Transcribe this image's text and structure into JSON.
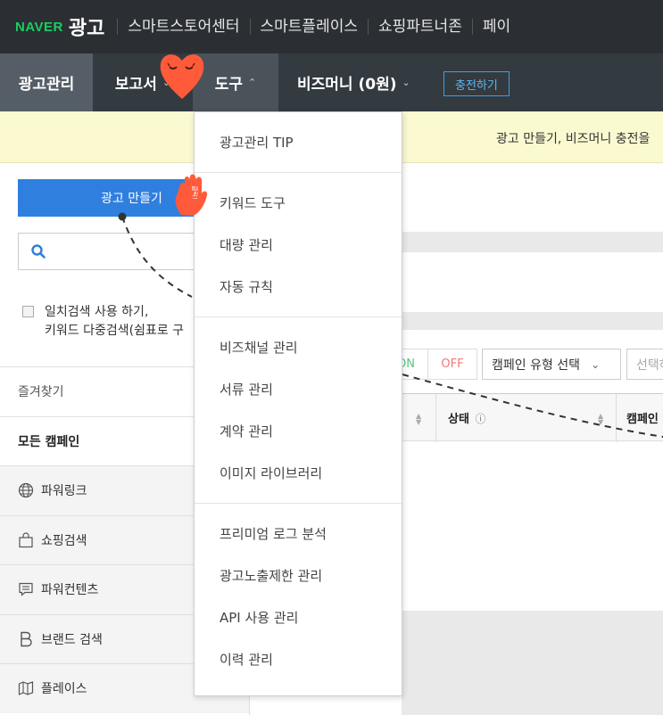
{
  "brand": {
    "logo_naver": "NAVER",
    "logo_ad": "광고",
    "links": [
      "스마트스토어센터",
      "스마트플레이스",
      "쇼핑파트너존",
      "페이"
    ]
  },
  "nav": {
    "ad_manage": "광고관리",
    "report": "보고서",
    "tools": "도구",
    "bizmoney": "비즈머니 (0원)",
    "charge": "충전하기"
  },
  "notice": {
    "text": "광고 만들기, 비즈머니 충전을"
  },
  "sidebar": {
    "create_button": "광고 만들기",
    "search_placeholder": "",
    "exact_match_line1": "일치검색 사용 하기,",
    "exact_match_line2": "키워드 다중검색(쉼표로 구",
    "items": [
      {
        "label": "즐겨찾기",
        "icon": "none"
      },
      {
        "label": "모든 캠페인",
        "icon": "none"
      },
      {
        "label": "파워링크",
        "icon": "globe-icon"
      },
      {
        "label": "쇼핑검색",
        "icon": "shopping-bag-icon"
      },
      {
        "label": "파워컨텐츠",
        "icon": "speech-bubble-icon"
      },
      {
        "label": "브랜드 검색",
        "icon": "brand-b-icon"
      },
      {
        "label": "플레이스",
        "icon": "map-icon"
      }
    ]
  },
  "content": {
    "toggle_on": "ON",
    "toggle_off": "OFF",
    "campaign_type_select": "캠페인 유형 선택",
    "select_partial": "선택하",
    "col_status": "상태",
    "col_campaign": "캠페인"
  },
  "dropdown": {
    "groups": [
      [
        "광고관리 TIP"
      ],
      [
        "키워드 도구",
        "대량 관리",
        "자동 규칙"
      ],
      [
        "비즈채널 관리",
        "서류 관리",
        "계약 관리",
        "이미지 라이브러리"
      ],
      [
        "프리미엄 로그 분석",
        "광고노출제한 관리",
        "API 사용 관리",
        "이력 관리"
      ]
    ]
  },
  "decor": {
    "hand_text": "클릭!"
  },
  "colors": {
    "brand_green": "#19ce60",
    "primary_blue": "#2f7fde",
    "sticker_orange": "#ff5a3a"
  }
}
